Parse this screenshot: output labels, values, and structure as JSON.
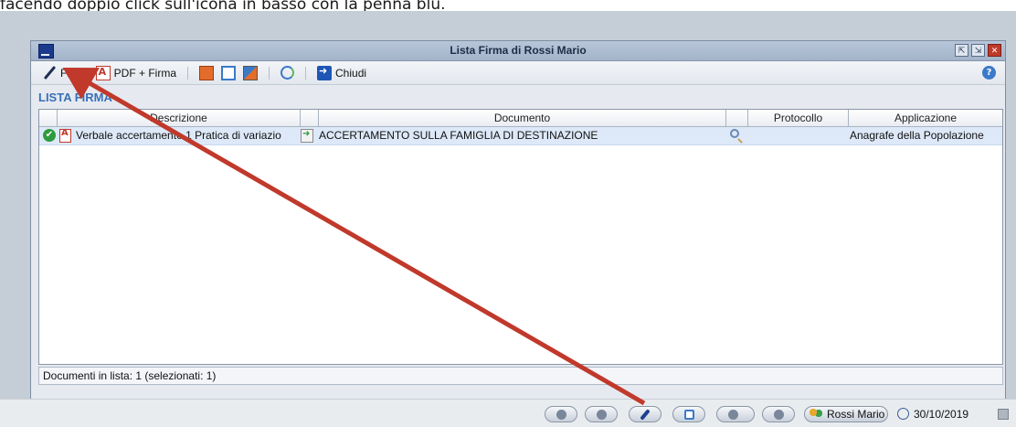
{
  "caption": "facendo doppio click sull'icona in basso con la penna blu.",
  "window": {
    "title": "Lista Firma di Rossi Mario",
    "buttons": {
      "minimize": "⇱",
      "maximize": "⇲",
      "close": "✕"
    }
  },
  "toolbar": {
    "firma_label": "Firma",
    "pdf_firma_label": "PDF + Firma",
    "chiudi_label": "Chiudi",
    "help_glyph": "?"
  },
  "section_title": "LISTA FIRMA",
  "table": {
    "headers": [
      "",
      "Descrizione",
      "",
      "Documento",
      "",
      "Protocollo",
      "Applicazione"
    ],
    "rows": [
      {
        "descrizione": "Verbale accertamento 1 Pratica di variazio",
        "documento": "ACCERTAMENTO SULLA FAMIGLIA DI DESTINAZIONE",
        "protocollo": "",
        "applicazione": "Anagrafe della Popolazione"
      }
    ]
  },
  "status": "Documenti in lista: 1 (selezionati: 1)",
  "taskbar": {
    "user": "Rossi Mario",
    "date": "30/10/2019"
  },
  "colors": {
    "arrow": "#c0392b",
    "section_title": "#3770b8",
    "selected_row": "#dde9f8"
  }
}
